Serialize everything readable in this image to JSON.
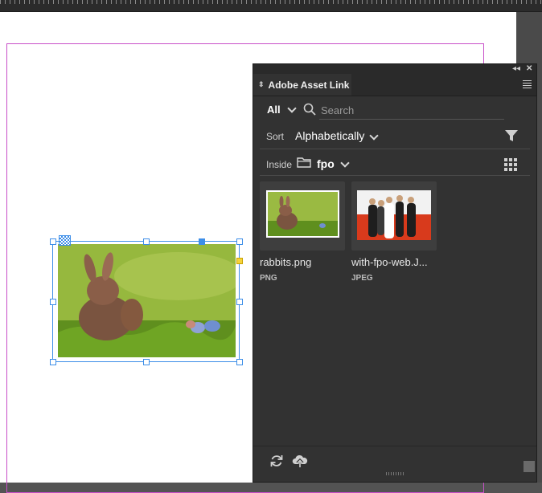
{
  "panel": {
    "title": "Adobe Asset Link",
    "filter": {
      "scope": "All",
      "search_placeholder": "Search"
    },
    "sort": {
      "label": "Sort",
      "value": "Alphabetically"
    },
    "location": {
      "label": "Inside",
      "folder": "fpo"
    },
    "assets": [
      {
        "name": "rabbits.png",
        "type": "PNG"
      },
      {
        "name": "with-fpo-web.J...",
        "type": "JPEG"
      }
    ]
  },
  "icons": {
    "search": "search-icon",
    "filter": "filter-icon",
    "folder": "folder-icon",
    "grid_view": "grid-view-icon",
    "refresh": "refresh-icon",
    "upload": "cloud-upload-icon",
    "menu": "panel-menu-icon"
  },
  "colors": {
    "panel_bg": "#323232",
    "frame_selection": "#3d8ee8",
    "margin_guide": "#c84fc8"
  }
}
